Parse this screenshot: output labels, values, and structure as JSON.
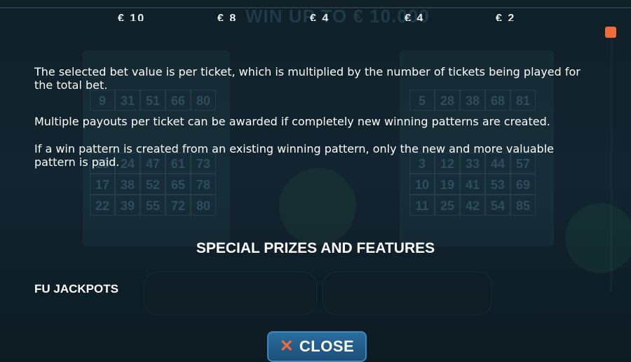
{
  "background": {
    "headline": "WIN UP TO € 10.000",
    "left_card_rows": [
      [
        "9",
        "31",
        "51",
        "66",
        "80"
      ],
      [
        "13",
        "24",
        "47",
        "61",
        "73"
      ],
      [
        "17",
        "38",
        "52",
        "65",
        "78"
      ],
      [
        "22",
        "39",
        "55",
        "72",
        "80"
      ]
    ],
    "right_card_rows": [
      [
        "5",
        "28",
        "38",
        "68",
        "81"
      ],
      [
        "3",
        "12",
        "33",
        "44",
        "57"
      ],
      [
        "10",
        "19",
        "41",
        "53",
        "69"
      ],
      [
        "11",
        "25",
        "42",
        "54",
        "85"
      ]
    ]
  },
  "prize_values": [
    "€ 10",
    "€ 8",
    "€ 4",
    "€ 4",
    "€ 2"
  ],
  "paragraphs": [
    "The selected bet value is per ticket, which is multiplied by the number of tickets being played for the total bet.",
    "Multiple payouts per ticket can be awarded if completely new winning patterns are created.",
    "If a win pattern is created from an existing winning pattern, only the new and more valuable pattern is paid."
  ],
  "section_title": "SPECIAL PRIZES AND FEATURES",
  "subsection_title": "FU JACKPOTS",
  "close_button": {
    "label": "CLOSE",
    "icon": "close-x-icon"
  },
  "colors": {
    "accent": "#f06a3c",
    "button": "#1f5a86",
    "background": "#0c1a22"
  }
}
